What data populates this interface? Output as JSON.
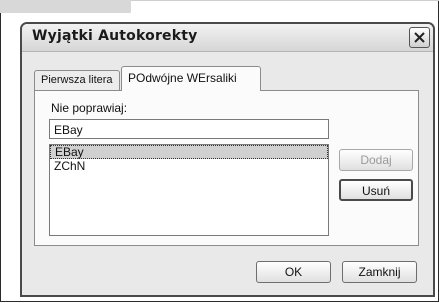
{
  "dialog": {
    "title": "Wyjątki Autokorekty",
    "close_icon": "close-icon"
  },
  "tabs": [
    {
      "label": "Pierwsza litera",
      "active": false
    },
    {
      "label": "POdwójne WErsaliki",
      "active": true
    }
  ],
  "panel": {
    "field_label": "Nie poprawiaj:",
    "input_value": "EBay",
    "list_items": [
      {
        "label": "EBay",
        "selected": true
      },
      {
        "label": "ZChN",
        "selected": false
      }
    ]
  },
  "buttons": {
    "add_label": "Dodaj",
    "remove_label": "Usuń",
    "ok_label": "OK",
    "close_label": "Zamknij"
  }
}
